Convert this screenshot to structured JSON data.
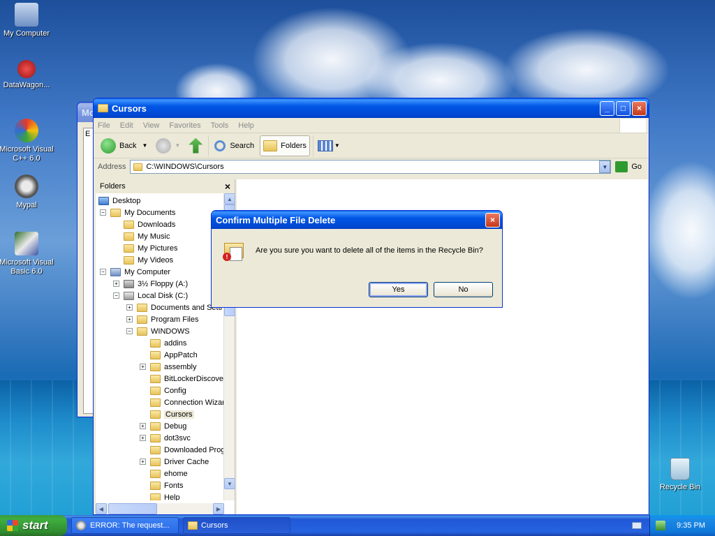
{
  "desktop": {
    "icons": [
      {
        "label": "My Computer"
      },
      {
        "label": "DataWagon..."
      },
      {
        "label": "Microsoft Visual C++ 6.0"
      },
      {
        "label": "Mypal"
      },
      {
        "label": "Microsoft Visual Basic 6.0"
      },
      {
        "label": "Recycle Bin"
      }
    ]
  },
  "background_window": {
    "title_fragment": "Mo",
    "side_letter": "E"
  },
  "explorer": {
    "title": "Cursors",
    "menu": [
      "File",
      "Edit",
      "View",
      "Favorites",
      "Tools",
      "Help"
    ],
    "toolbar": {
      "back": "Back",
      "search": "Search",
      "folders": "Folders"
    },
    "address": {
      "label": "Address",
      "value": "C:\\WINDOWS\\Cursors",
      "go": "Go"
    },
    "folders_pane": {
      "title": "Folders",
      "close": "×",
      "tree": [
        {
          "label": "Desktop",
          "expander": ""
        },
        {
          "label": "My Documents",
          "expander": "−"
        },
        {
          "label": "Downloads",
          "expander": ""
        },
        {
          "label": "My Music",
          "expander": ""
        },
        {
          "label": "My Pictures",
          "expander": ""
        },
        {
          "label": "My Videos",
          "expander": ""
        },
        {
          "label": "My Computer",
          "expander": "−"
        },
        {
          "label": "3½ Floppy (A:)",
          "expander": "+"
        },
        {
          "label": "Local Disk (C:)",
          "expander": "−"
        },
        {
          "label": "Documents and Setti",
          "expander": "+"
        },
        {
          "label": "Program Files",
          "expander": "+"
        },
        {
          "label": "WINDOWS",
          "expander": "−"
        },
        {
          "label": "addins",
          "expander": ""
        },
        {
          "label": "AppPatch",
          "expander": ""
        },
        {
          "label": "assembly",
          "expander": "+"
        },
        {
          "label": "BitLockerDiscover",
          "expander": ""
        },
        {
          "label": "Config",
          "expander": ""
        },
        {
          "label": "Connection Wizar",
          "expander": ""
        },
        {
          "label": "Cursors",
          "expander": ""
        },
        {
          "label": "Debug",
          "expander": "+"
        },
        {
          "label": "dot3svc",
          "expander": "+"
        },
        {
          "label": "Downloaded Prog",
          "expander": ""
        },
        {
          "label": "Driver Cache",
          "expander": "+"
        },
        {
          "label": "ehome",
          "expander": ""
        },
        {
          "label": "Fonts",
          "expander": ""
        },
        {
          "label": "Help",
          "expander": ""
        }
      ]
    }
  },
  "dialog": {
    "title": "Confirm Multiple File Delete",
    "message": "Are you sure you want to delete all of the items in the Recycle Bin?",
    "yes": "Yes",
    "no": "No"
  },
  "taskbar": {
    "start": "start",
    "tasks": [
      "ERROR: The request...",
      "Cursors"
    ],
    "clock": "9:35 PM"
  }
}
